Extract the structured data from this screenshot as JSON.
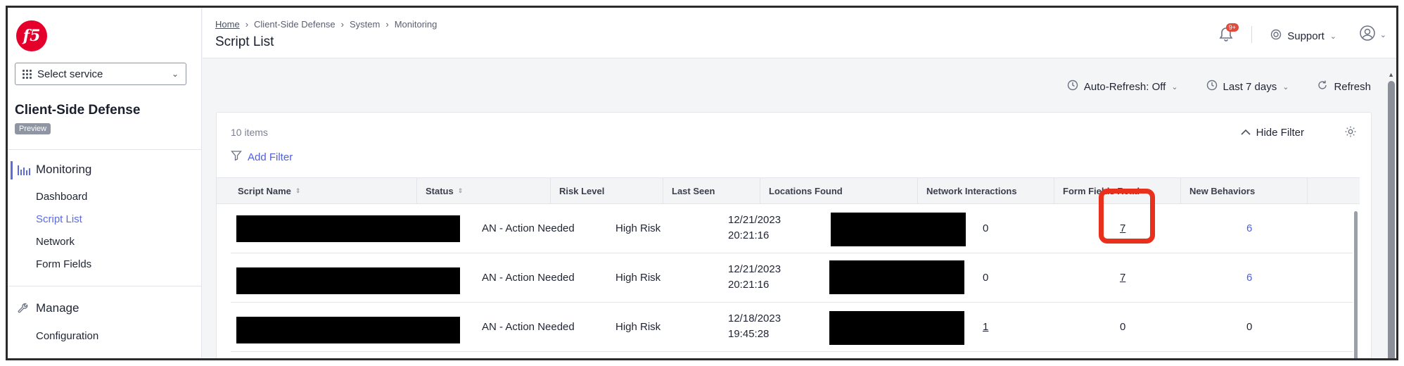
{
  "sidebar": {
    "logo_text": "f5",
    "select_service": "Select service",
    "service_title": "Client-Side Defense",
    "preview_badge": "Preview",
    "monitoring_label": "Monitoring",
    "monitoring_items": [
      "Dashboard",
      "Script List",
      "Network",
      "Form Fields"
    ],
    "manage_label": "Manage",
    "manage_items": [
      "Configuration"
    ]
  },
  "header": {
    "breadcrumb": [
      "Home",
      "Client-Side Defense",
      "System",
      "Monitoring"
    ],
    "title": "Script List",
    "notification_badge": "9+",
    "support_label": "Support"
  },
  "toolbar": {
    "auto_refresh": "Auto-Refresh: Off",
    "time_range": "Last 7 days",
    "refresh": "Refresh"
  },
  "panel": {
    "items_count": "10 items",
    "add_filter": "Add Filter",
    "hide_filter": "Hide Filter"
  },
  "table": {
    "columns": [
      "Script Name",
      "Status",
      "Risk Level",
      "Last Seen",
      "Locations Found",
      "Network Interactions",
      "Form Fields Read",
      "New Behaviors"
    ],
    "rows": [
      {
        "status": "AN - Action Needed",
        "risk": "High Risk",
        "date": "12/21/2023",
        "time": "20:21:16",
        "network": "0",
        "form_fields": "7",
        "new_behaviors": "6"
      },
      {
        "status": "AN - Action Needed",
        "risk": "High Risk",
        "date": "12/21/2023",
        "time": "20:21:16",
        "network": "0",
        "form_fields": "7",
        "new_behaviors": "6"
      },
      {
        "status": "AN - Action Needed",
        "risk": "High Risk",
        "date": "12/18/2023",
        "time": "19:45:28",
        "network": "1",
        "form_fields": "0",
        "new_behaviors": "0"
      }
    ]
  },
  "colors": {
    "accent": "#4f60d8",
    "brand": "#e4002b",
    "highlight": "#e8301c"
  }
}
